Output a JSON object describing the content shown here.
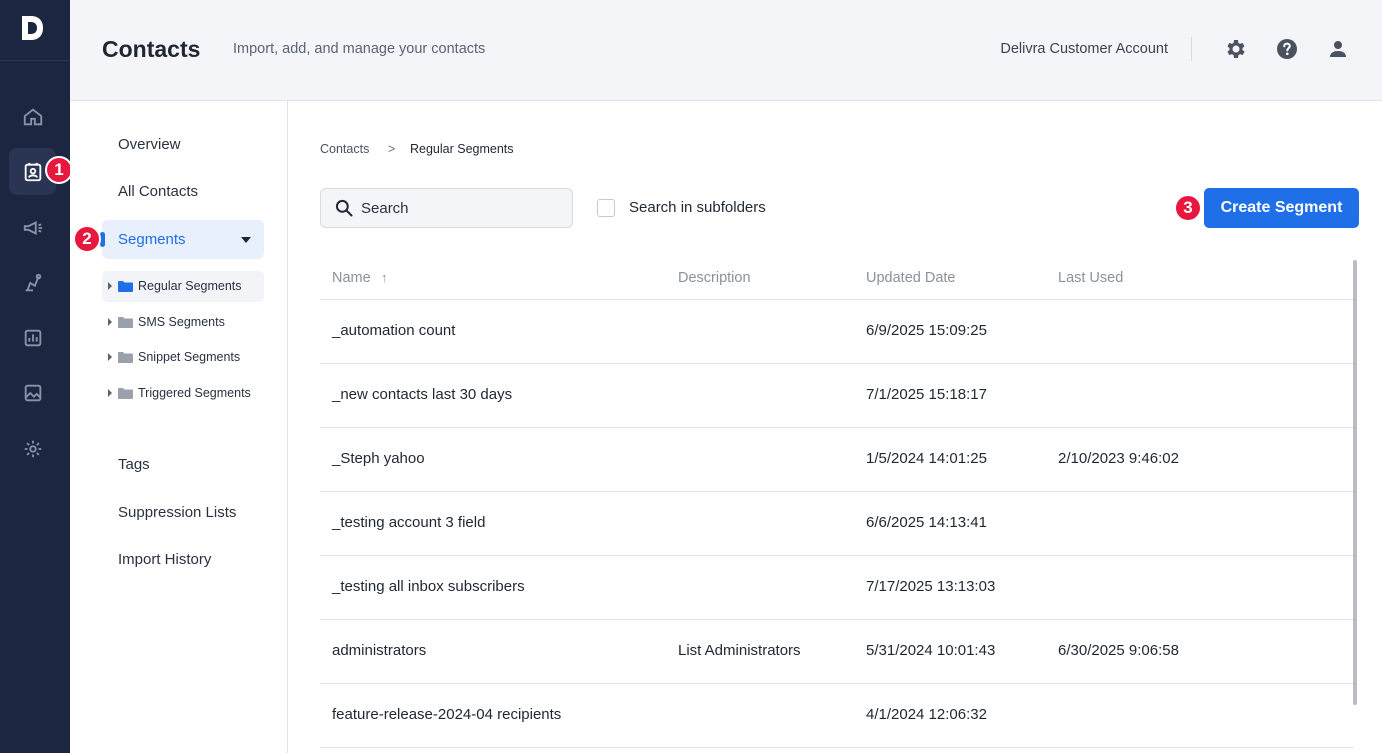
{
  "app": {
    "logo_letter": "D"
  },
  "rail": {
    "items": [
      "home-icon",
      "contacts-icon",
      "campaigns-icon",
      "automation-icon",
      "reports-icon",
      "media-icon",
      "settings-icon"
    ],
    "active": "contacts-icon"
  },
  "annotations": {
    "badge1": "1",
    "badge2": "2",
    "badge3": "3"
  },
  "header": {
    "title": "Contacts",
    "subtitle": "Import, add, and manage your contacts",
    "account": "Delivra Customer Account"
  },
  "subnav": {
    "overview": "Overview",
    "all_contacts": "All Contacts",
    "segments": "Segments",
    "folders": [
      {
        "label": "Regular Segments",
        "active": true
      },
      {
        "label": "SMS Segments",
        "active": false
      },
      {
        "label": "Snippet Segments",
        "active": false
      },
      {
        "label": "Triggered Segments",
        "active": false
      }
    ],
    "tags": "Tags",
    "suppression": "Suppression Lists",
    "import_history": "Import History"
  },
  "breadcrumb": {
    "root": "Contacts",
    "separator": ">",
    "current": "Regular Segments"
  },
  "toolbar": {
    "search_placeholder": "Search",
    "subfolders_label": "Search in subfolders",
    "create_label": "Create Segment"
  },
  "table": {
    "headers": {
      "name": "Name",
      "sort": "↑",
      "description": "Description",
      "updated": "Updated Date",
      "last_used": "Last Used"
    },
    "rows": [
      {
        "name": "_automation count",
        "description": "",
        "updated": "6/9/2025 15:09:25",
        "last_used": ""
      },
      {
        "name": "_new contacts last 30 days",
        "description": "",
        "updated": "7/1/2025 15:18:17",
        "last_used": ""
      },
      {
        "name": "_Steph yahoo",
        "description": "",
        "updated": "1/5/2024 14:01:25",
        "last_used": "2/10/2023 9:46:02"
      },
      {
        "name": "_testing account 3 field",
        "description": "",
        "updated": "6/6/2025 14:13:41",
        "last_used": ""
      },
      {
        "name": "_testing all inbox subscribers",
        "description": "",
        "updated": "7/17/2025 13:13:03",
        "last_used": ""
      },
      {
        "name": "administrators",
        "description": "List Administrators",
        "updated": "5/31/2024 10:01:43",
        "last_used": "6/30/2025 9:06:58"
      },
      {
        "name": "feature-release-2024-04 recipients",
        "description": "",
        "updated": "4/1/2024 12:06:32",
        "last_used": ""
      }
    ]
  },
  "colors": {
    "rail_bg": "#1c2640",
    "accent": "#1f6fe8",
    "badge": "#e8173f"
  }
}
